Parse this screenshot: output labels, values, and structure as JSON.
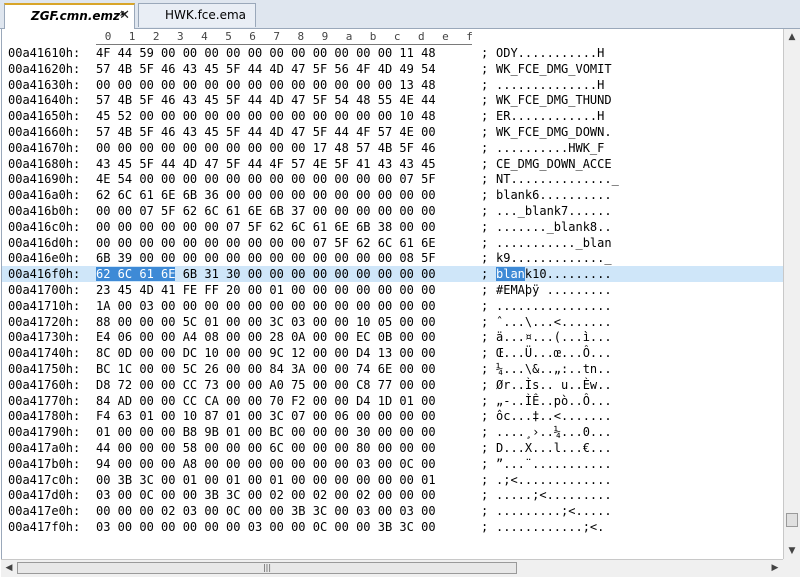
{
  "tabs": [
    {
      "label": "ZGF.cmn.emz*",
      "close": "✕"
    },
    {
      "label": "HWK.fce.ema"
    }
  ],
  "column_headers": [
    "0",
    "1",
    "2",
    "3",
    "4",
    "5",
    "6",
    "7",
    "8",
    "9",
    "a",
    "b",
    "c",
    "d",
    "e",
    "f"
  ],
  "separator": ";",
  "selected_row_index": 14,
  "highlight": {
    "hex_bytes": 4,
    "ascii_chars": 4
  },
  "rows": [
    {
      "addr": "00a41610h:",
      "hex": "4F 44 59 00 00 00 00 00 00 00 00 00 00 00 11 48",
      "ascii": "ODY...........H"
    },
    {
      "addr": "00a41620h:",
      "hex": "57 4B 5F 46 43 45 5F 44 4D 47 5F 56 4F 4D 49 54",
      "ascii": "WK_FCE_DMG_VOMIT"
    },
    {
      "addr": "00a41630h:",
      "hex": "00 00 00 00 00 00 00 00 00 00 00 00 00 00 13 48",
      "ascii": "..............H"
    },
    {
      "addr": "00a41640h:",
      "hex": "57 4B 5F 46 43 45 5F 44 4D 47 5F 54 48 55 4E 44",
      "ascii": "WK_FCE_DMG_THUND"
    },
    {
      "addr": "00a41650h:",
      "hex": "45 52 00 00 00 00 00 00 00 00 00 00 00 00 10 48",
      "ascii": "ER............H"
    },
    {
      "addr": "00a41660h:",
      "hex": "57 4B 5F 46 43 45 5F 44 4D 47 5F 44 4F 57 4E 00",
      "ascii": "WK_FCE_DMG_DOWN."
    },
    {
      "addr": "00a41670h:",
      "hex": "00 00 00 00 00 00 00 00 00 00 17 48 57 4B 5F 46",
      "ascii": "..........HWK_F"
    },
    {
      "addr": "00a41680h:",
      "hex": "43 45 5F 44 4D 47 5F 44 4F 57 4E 5F 41 43 43 45",
      "ascii": "CE_DMG_DOWN_ACCE"
    },
    {
      "addr": "00a41690h:",
      "hex": "4E 54 00 00 00 00 00 00 00 00 00 00 00 00 07 5F",
      "ascii": "NT.............._"
    },
    {
      "addr": "00a416a0h:",
      "hex": "62 6C 61 6E 6B 36 00 00 00 00 00 00 00 00 00 00",
      "ascii": "blank6.........."
    },
    {
      "addr": "00a416b0h:",
      "hex": "00 00 07 5F 62 6C 61 6E 6B 37 00 00 00 00 00 00",
      "ascii": "..._blank7......"
    },
    {
      "addr": "00a416c0h:",
      "hex": "00 00 00 00 00 00 07 5F 62 6C 61 6E 6B 38 00 00",
      "ascii": "......._blank8.."
    },
    {
      "addr": "00a416d0h:",
      "hex": "00 00 00 00 00 00 00 00 00 00 07 5F 62 6C 61 6E",
      "ascii": "..........._blan"
    },
    {
      "addr": "00a416e0h:",
      "hex": "6B 39 00 00 00 00 00 00 00 00 00 00 00 00 08 5F",
      "ascii": "k9............._"
    },
    {
      "addr": "00a416f0h:",
      "hex": "62 6C 61 6E 6B 31 30 00 00 00 00 00 00 00 00 00",
      "ascii": "blank10........."
    },
    {
      "addr": "00a41700h:",
      "hex": "23 45 4D 41 FE FF 20 00 01 00 00 00 00 00 00 00",
      "ascii": "#EMAþÿ ........."
    },
    {
      "addr": "00a41710h:",
      "hex": "1A 00 03 00 00 00 00 00 00 00 00 00 00 00 00 00",
      "ascii": "................"
    },
    {
      "addr": "00a41720h:",
      "hex": "88 00 00 00 5C 01 00 00 3C 03 00 00 10 05 00 00",
      "ascii": "ˆ...\\...<......."
    },
    {
      "addr": "00a41730h:",
      "hex": "E4 06 00 00 A4 08 00 00 28 0A 00 00 EC 0B 00 00",
      "ascii": "ä...¤...(...ì..."
    },
    {
      "addr": "00a41740h:",
      "hex": "8C 0D 00 00 DC 10 00 00 9C 12 00 00 D4 13 00 00",
      "ascii": "Œ...Ü...œ...Ô..."
    },
    {
      "addr": "00a41750h:",
      "hex": "BC 1C 00 00 5C 26 00 00 84 3A 00 00 74 6E 00 00",
      "ascii": "¼...\\&..„:..tn.."
    },
    {
      "addr": "00a41760h:",
      "hex": "D8 72 00 00 CC 73 00 00 A0 75 00 00 C8 77 00 00",
      "ascii": "Ør..Ìs.. u..Èw.."
    },
    {
      "addr": "00a41770h:",
      "hex": "84 AD 00 00 CC CA 00 00 70 F2 00 00 D4 1D 01 00",
      "ascii": "„-..ÌÊ..pò..Ô..."
    },
    {
      "addr": "00a41780h:",
      "hex": "F4 63 01 00 10 87 01 00 3C 07 00 06 00 00 00 00",
      "ascii": "ôc...‡..<......."
    },
    {
      "addr": "00a41790h:",
      "hex": "01 00 00 00 B8 9B 01 00 BC 00 00 00 30 00 00 00",
      "ascii": "....¸›..¼...0..."
    },
    {
      "addr": "00a417a0h:",
      "hex": "44 00 00 00 58 00 00 00 6C 00 00 00 80 00 00 00",
      "ascii": "D...X...l...€..."
    },
    {
      "addr": "00a417b0h:",
      "hex": "94 00 00 00 A8 00 00 00 00 00 00 00 03 00 0C 00",
      "ascii": "”...¨..........."
    },
    {
      "addr": "00a417c0h:",
      "hex": "00 3B 3C 00 01 00 01 00 01 00 00 00 00 00 00 01",
      "ascii": ".;<............."
    },
    {
      "addr": "00a417d0h:",
      "hex": "03 00 0C 00 00 3B 3C 00 02 00 02 00 02 00 00 00",
      "ascii": ".....;<........."
    },
    {
      "addr": "00a417e0h:",
      "hex": "00 00 00 02 03 00 0C 00 00 3B 3C 00 03 00 03 00",
      "ascii": ".........;<....."
    },
    {
      "addr": "00a417f0h:",
      "hex": "03 00 00 00 00 00 00 03 00 00 0C 00 00 3B 3C 00",
      "ascii": "............;<."
    }
  ],
  "icons": {
    "scroll_up": "up-arrow-icon",
    "scroll_down": "down-arrow-icon",
    "scroll_left": "left-arrow-icon",
    "scroll_right": "right-arrow-icon"
  }
}
